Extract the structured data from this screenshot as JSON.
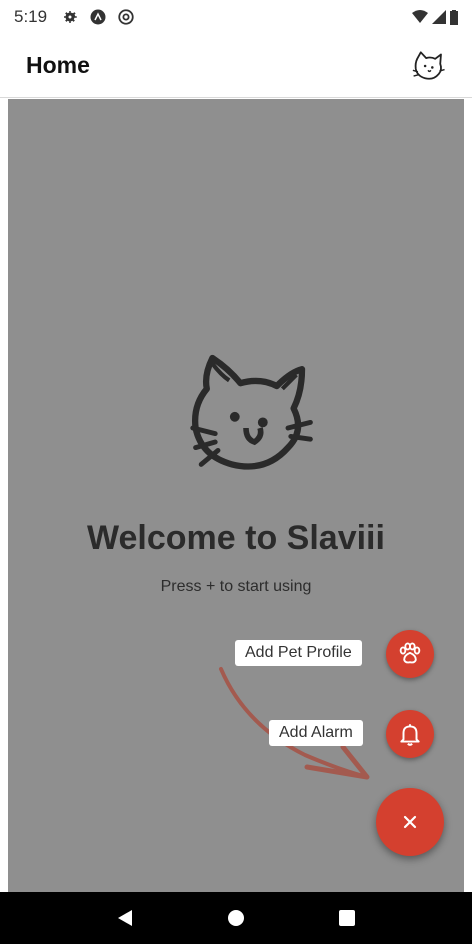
{
  "status_bar": {
    "time": "5:19",
    "icons_left": [
      "gear-icon",
      "app-notification-icon",
      "at-sign-icon"
    ],
    "icons_right": [
      "wifi-icon",
      "signal-icon",
      "battery-icon"
    ]
  },
  "app_bar": {
    "title": "Home",
    "logo_icon": "cat-logo-icon"
  },
  "welcome": {
    "logo_icon": "cat-logo-icon",
    "title": "Welcome to Slaviii",
    "subtitle": "Press + to start using"
  },
  "speed_dial": {
    "actions": [
      {
        "label": "Add Pet Profile",
        "icon": "paw-icon"
      },
      {
        "label": "Add Alarm",
        "icon": "bell-icon"
      }
    ],
    "main_icon": "close-icon",
    "accent_color": "#d4402f",
    "scrim_color": "#8f8f8f"
  },
  "nav_bar": {
    "buttons": [
      "back-icon",
      "home-icon",
      "recents-icon"
    ]
  }
}
